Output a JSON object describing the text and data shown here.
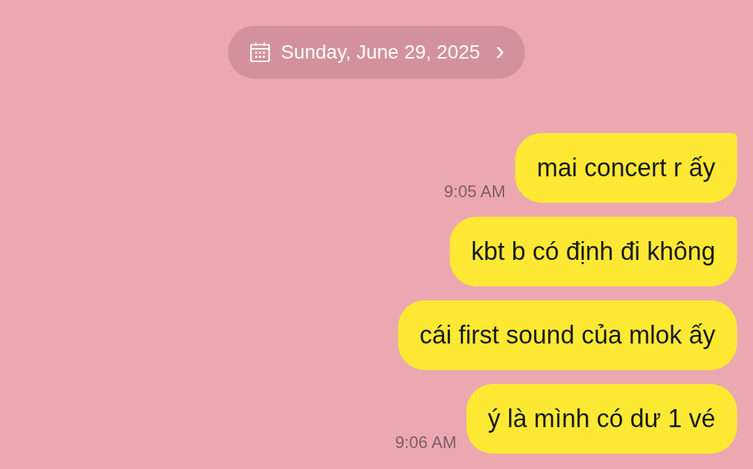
{
  "date_header": {
    "label": "Sunday, June 29, 2025",
    "chevron": "›"
  },
  "messages": [
    {
      "text": "mai concert r ấy",
      "time": "9:05 AM",
      "tail": true
    },
    {
      "text": "kbt b có định đi không",
      "tail": true
    },
    {
      "text": "cái first sound của mlok ấy",
      "tail": false
    },
    {
      "text": "ý là mình có dư 1 vé",
      "time": "9:06 AM",
      "tail": false
    }
  ]
}
